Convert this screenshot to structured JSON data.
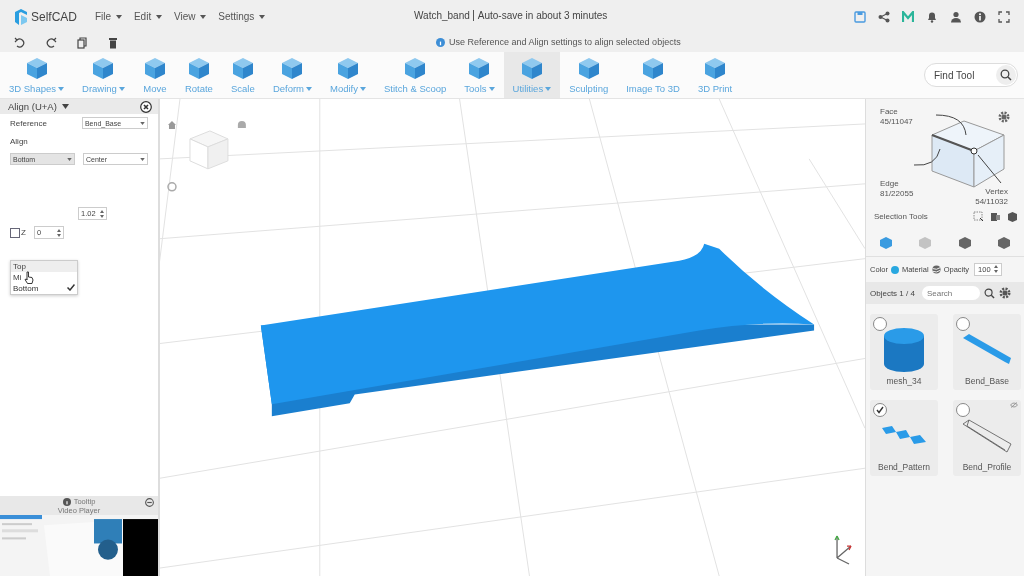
{
  "header": {
    "logo": "SelfCAD",
    "menus": [
      {
        "label": "File"
      },
      {
        "label": "Edit"
      },
      {
        "label": "View"
      },
      {
        "label": "Settings"
      }
    ],
    "file_name": "Watch_band",
    "autosave": "Auto-save in about 3 minutes"
  },
  "hint": "Use Reference and Align settings to align selected objects",
  "toolbar": {
    "tools": [
      {
        "label": "3D Shapes",
        "dropdown": true,
        "selected": false
      },
      {
        "label": "Drawing",
        "dropdown": true,
        "selected": false
      },
      {
        "label": "Move",
        "dropdown": false,
        "selected": false
      },
      {
        "label": "Rotate",
        "dropdown": false,
        "selected": false
      },
      {
        "label": "Scale",
        "dropdown": false,
        "selected": false
      },
      {
        "label": "Deform",
        "dropdown": true,
        "selected": false
      },
      {
        "label": "Modify",
        "dropdown": true,
        "selected": false
      },
      {
        "label": "Stitch & Scoop",
        "dropdown": false,
        "selected": false
      },
      {
        "label": "Tools",
        "dropdown": true,
        "selected": false
      },
      {
        "label": "Utilities",
        "dropdown": true,
        "selected": true
      },
      {
        "label": "Sculpting",
        "dropdown": false,
        "selected": false
      },
      {
        "label": "Image To 3D",
        "dropdown": false,
        "selected": false
      },
      {
        "label": "3D Print",
        "dropdown": false,
        "selected": false
      }
    ],
    "search": {
      "placeholder": "Find Tool"
    }
  },
  "align_panel": {
    "title": "Align (U+A)",
    "reference_label": "Reference",
    "reference_value": "Bend_Base",
    "align_label": "Align",
    "align_value": "Bottom",
    "align_mode": "Center",
    "options": [
      {
        "label": "Top",
        "selected": false
      },
      {
        "label": "Mi",
        "selected": false
      },
      {
        "label": "Bottom",
        "selected": true
      }
    ],
    "y_value": "1.02",
    "z": {
      "label": "Z",
      "checked": false,
      "value": "0"
    }
  },
  "video": {
    "title": "Tooltip",
    "subtitle": "Video Player"
  },
  "selection": {
    "face_label": "Face",
    "face_count": "45/11047",
    "edge_label": "Edge",
    "edge_count": "81/22055",
    "vertex_label": "Vertex",
    "vertex_count": "54/11032",
    "tools_label": "Selection Tools",
    "modes": [
      {
        "selected": true
      },
      {
        "selected": false
      },
      {
        "selected": false
      },
      {
        "selected": false
      }
    ]
  },
  "properties": {
    "color_label": "Color",
    "material_label": "Material",
    "opacity_label": "Opacity",
    "opacity": "100"
  },
  "objects": {
    "count": "Objects 1 / 4",
    "search_placeholder": "Search",
    "items": [
      {
        "name": "mesh_34",
        "selected": false,
        "hidden": false
      },
      {
        "name": "Bend_Base",
        "selected": false,
        "hidden": false
      },
      {
        "name": "Bend_Pattern",
        "selected": true,
        "hidden": false
      },
      {
        "name": "Bend_Profile",
        "selected": false,
        "hidden": true
      }
    ]
  }
}
